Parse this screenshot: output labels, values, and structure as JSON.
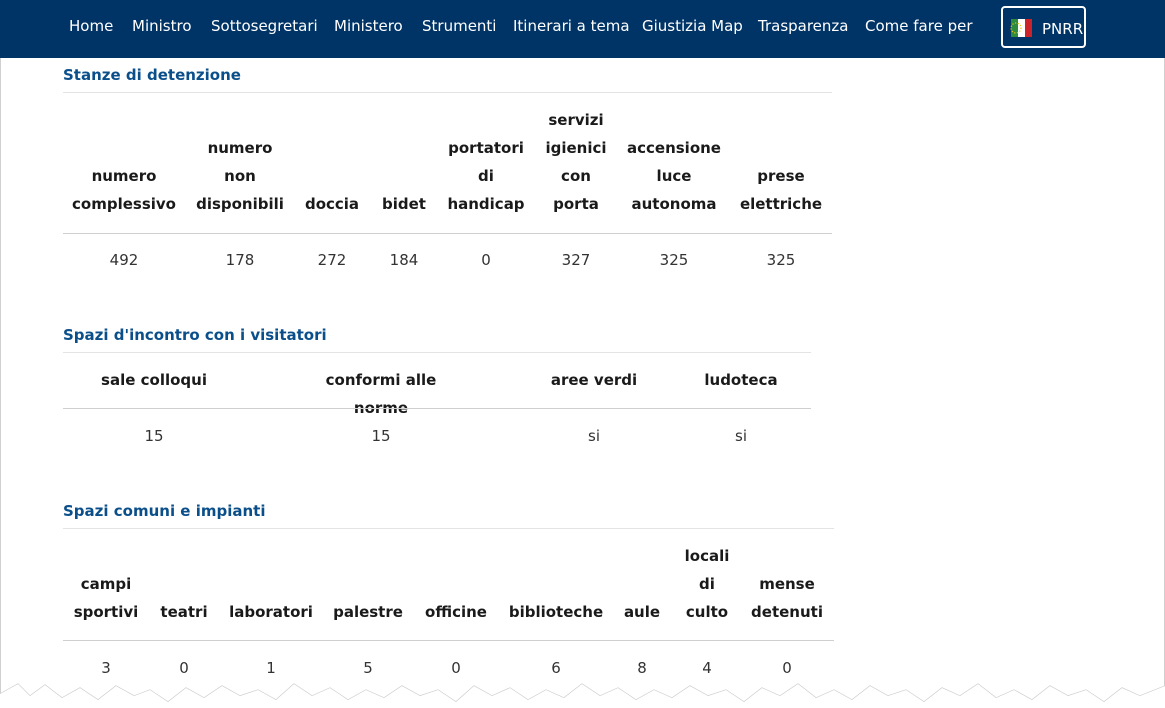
{
  "nav": {
    "items": [
      "Home",
      "Ministro",
      "Sottosegretari",
      "Ministero",
      "Strumenti",
      "Itinerari a tema",
      "Giustizia Map",
      "Trasparenza",
      "Come fare per"
    ],
    "pnrr_label": "PNRR",
    "icon": "pnrr-flag-icon",
    "colors": {
      "bar": "#003366",
      "text": "#ffffff"
    }
  },
  "stanze": {
    "title": "Stanze di detenzione",
    "headers": [
      [
        "numero",
        "complessivo"
      ],
      [
        "numero",
        "non",
        "disponibili"
      ],
      [
        "doccia"
      ],
      [
        "bidet"
      ],
      [
        "portatori",
        "di",
        "handicap"
      ],
      [
        "servizi",
        "igienici",
        "con",
        "porta"
      ],
      [
        "accensione",
        "luce",
        "autonoma"
      ],
      [
        "prese",
        "elettriche"
      ]
    ],
    "values": [
      "492",
      "178",
      "272",
      "184",
      "0",
      "327",
      "325",
      "325"
    ]
  },
  "spazi_incontro": {
    "title": "Spazi d'incontro con i visitatori",
    "headers": [
      "sale colloqui",
      "conformi alle norme",
      "aree verdi",
      "ludoteca"
    ],
    "values": [
      "15",
      "15",
      "si",
      "si"
    ]
  },
  "spazi_comuni": {
    "title": "Spazi comuni e impianti",
    "headers": [
      [
        "campi",
        "sportivi"
      ],
      [
        "teatri"
      ],
      [
        "laboratori"
      ],
      [
        "palestre"
      ],
      [
        "officine"
      ],
      [
        "biblioteche"
      ],
      [
        "aule"
      ],
      [
        "locali",
        "di",
        "culto"
      ],
      [
        "mense",
        "detenuti"
      ]
    ],
    "values": [
      "3",
      "0",
      "1",
      "5",
      "0",
      "6",
      "8",
      "4",
      "0"
    ]
  },
  "colors": {
    "section_title": "#0b4f8a"
  }
}
